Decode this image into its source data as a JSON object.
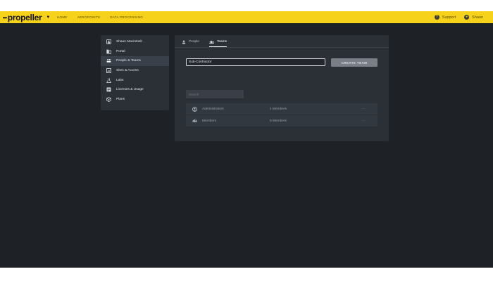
{
  "brand": {
    "name": "propeller"
  },
  "nav": {
    "items": [
      "HOME",
      "AEROPOINTS",
      "DATA PROCESSING"
    ]
  },
  "header_right": {
    "support_label": "Support",
    "user_label": "Shaun"
  },
  "sidebar": {
    "items": [
      {
        "label": "Shaun Macintosh",
        "icon": "user-icon",
        "active": false
      },
      {
        "label": "Portal",
        "icon": "portal-icon",
        "active": false
      },
      {
        "label": "People & Teams",
        "icon": "people-icon",
        "active": true
      },
      {
        "label": "Sites & Access",
        "icon": "sites-icon",
        "active": false
      },
      {
        "label": "Labs",
        "icon": "flask-icon",
        "active": false
      },
      {
        "label": "Licenses & Usage",
        "icon": "licenses-icon",
        "active": false
      },
      {
        "label": "Plans",
        "icon": "cube-icon",
        "active": false
      }
    ]
  },
  "tabs": [
    {
      "label": "People",
      "icon": "person-icon",
      "active": false
    },
    {
      "label": "Teams",
      "icon": "team-icon",
      "active": true
    }
  ],
  "create_team": {
    "input_value": "Sub-Contractor",
    "button_label": "CREATE TEAM"
  },
  "search": {
    "placeholder": "Search"
  },
  "teams": [
    {
      "name": "Administrators",
      "members": "1 Members",
      "icon": "admin-icon"
    },
    {
      "name": "Members",
      "members": "5 Members",
      "icon": "team-icon"
    }
  ],
  "colors": {
    "brand_yellow": "#f6d21b",
    "background": "#1e2226",
    "panel": "#2b3037"
  }
}
